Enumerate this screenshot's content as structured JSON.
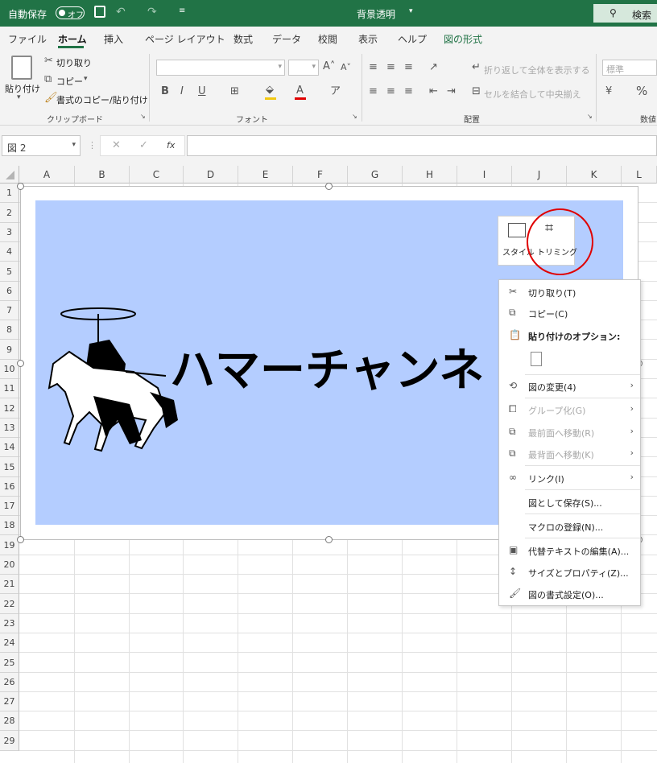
{
  "titlebar": {
    "autosave_label": "自動保存",
    "autosave_state": "オフ",
    "filename": "背景透明",
    "search_label": "検索"
  },
  "tabs": [
    "ファイル",
    "ホーム",
    "挿入",
    "ページ レイアウト",
    "数式",
    "データ",
    "校閲",
    "表示",
    "ヘルプ",
    "図の形式"
  ],
  "ribbon": {
    "clipboard": {
      "paste": "貼り付け",
      "cut": "切り取り",
      "copy": "コピー",
      "format_painter": "書式のコピー/貼り付け",
      "group": "クリップボード"
    },
    "font": {
      "group": "フォント"
    },
    "alignment": {
      "wrap": "折り返して全体を表示する",
      "merge": "セルを結合して中央揃え",
      "group": "配置"
    },
    "number": {
      "format": "標準",
      "group": "数値"
    }
  },
  "formula_bar": {
    "name_box": "図 2",
    "fx": "fx"
  },
  "columns": [
    "A",
    "B",
    "C",
    "D",
    "E",
    "F",
    "G",
    "H",
    "I",
    "J",
    "K",
    "L"
  ],
  "rows": [
    "1",
    "2",
    "3",
    "4",
    "5",
    "6",
    "7",
    "8",
    "9",
    "10",
    "11",
    "12",
    "13",
    "14",
    "15",
    "16",
    "17",
    "18",
    "19",
    "20",
    "21",
    "22",
    "23",
    "24",
    "25",
    "26",
    "27",
    "28",
    "29"
  ],
  "picture": {
    "text": "ハマーチャンネ",
    "bg_color": "#b4cdff"
  },
  "float_toolbar": {
    "style": "スタイル",
    "trim": "トリミング"
  },
  "context_menu": {
    "cut": "切り取り(T)",
    "copy": "コピー(C)",
    "paste_options": "貼り付けのオプション:",
    "change_picture": "図の変更(4)",
    "group": "グループ化(G)",
    "bring_front": "最前面へ移動(R)",
    "send_back": "最背面へ移動(K)",
    "link": "リンク(I)",
    "save_as_picture": "図として保存(S)...",
    "assign_macro": "マクロの登録(N)...",
    "alt_text": "代替テキストの編集(A)...",
    "size_props": "サイズとプロパティ(Z)...",
    "format_picture": "図の書式設定(O)..."
  },
  "colors": {
    "accent": "#217346",
    "highlight_circle": "#e00000"
  }
}
